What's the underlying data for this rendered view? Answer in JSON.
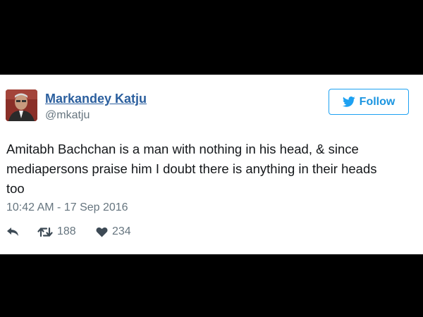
{
  "tweet": {
    "author": {
      "name": "Markandey Katju",
      "handle": "@mkatju",
      "avatar_icon": "profile-photo"
    },
    "follow_button": {
      "label": "Follow",
      "icon": "twitter-bird-icon",
      "accent_color": "#1da1f2"
    },
    "text_lines": [
      "Amitabh Bachchan is a man with nothing in his head, & since",
      "mediapersons praise him I doubt there is anything in their heads",
      "too"
    ],
    "timestamp": "10:42 AM - 17 Sep 2016",
    "actions": {
      "reply": {
        "icon": "reply-icon"
      },
      "retweet": {
        "icon": "retweet-icon",
        "count": "188"
      },
      "like": {
        "icon": "heart-icon",
        "count": "234"
      }
    }
  },
  "colors": {
    "background": "#000000",
    "card": "#ffffff",
    "name_link": "#2b5f9e",
    "secondary_text": "#66757f",
    "body_text": "#14171a"
  }
}
